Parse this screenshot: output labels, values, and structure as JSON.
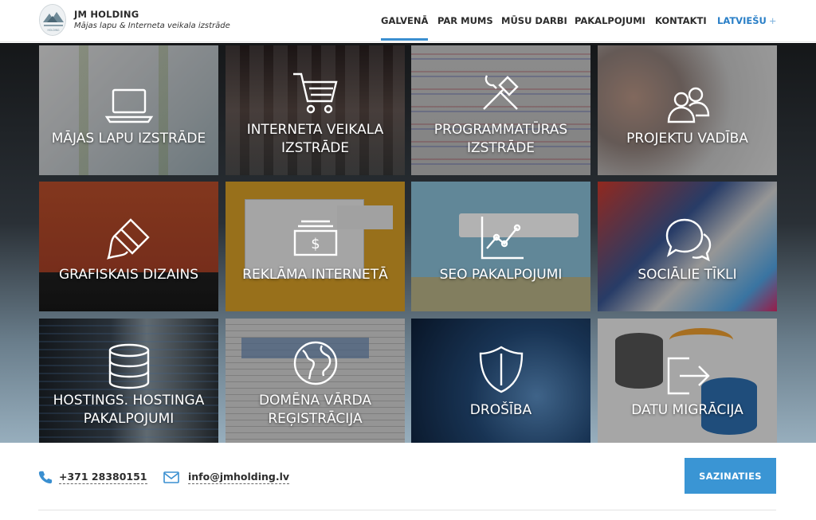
{
  "header": {
    "brand_title": "JM HOLDING",
    "brand_subtitle": "Mājas lapu & Interneta veikala izstrāde",
    "logo_text": "JM HOLDING",
    "nav": [
      {
        "label": "GALVENĀ",
        "active": true
      },
      {
        "label": "PAR MUMS"
      },
      {
        "label": "MŪSU DARBI"
      },
      {
        "label": "PAKALPOJUMI"
      },
      {
        "label": "KONTAKTI"
      },
      {
        "label": "LATVIEŠU",
        "suffix": "+"
      }
    ]
  },
  "services": [
    {
      "label": "MĀJAS LAPU IZSTRĀDE",
      "icon": "laptop-icon"
    },
    {
      "label": "INTERNETA VEIKALA IZSTRĀDE",
      "icon": "shopping-cart-icon"
    },
    {
      "label": "PROGRAMMATŪRAS IZSTRĀDE",
      "icon": "tools-icon"
    },
    {
      "label": "PROJEKTU VADĪBA",
      "icon": "users-icon"
    },
    {
      "label": "GRAFISKAIS DIZAINS",
      "icon": "paint-brush-icon"
    },
    {
      "label": "REKLĀMA INTERNETĀ",
      "icon": "money-icon"
    },
    {
      "label": "SEO PAKALPOJUMI",
      "icon": "search-chart-icon"
    },
    {
      "label": "SOCIĀLIE TĪKLI",
      "icon": "chat-bubbles-icon"
    },
    {
      "label": "HOSTINGS. HOSTINGA PAKALPOJUMI",
      "icon": "database-icon"
    },
    {
      "label": "DOMĒNA VĀRDA REĢISTRĀCIJA",
      "icon": "globe-icon"
    },
    {
      "label": "DROŠĪBA",
      "icon": "shield-icon"
    },
    {
      "label": "DATU MIGRĀCIJA",
      "icon": "sign-out-icon"
    }
  ],
  "contact": {
    "phone": "+371 28380151",
    "email": "info@jmholding.lv",
    "button_label": "SAZINATIES"
  },
  "colors": {
    "accent": "#3a95d4",
    "nav_lang": "#2a7fc7"
  }
}
